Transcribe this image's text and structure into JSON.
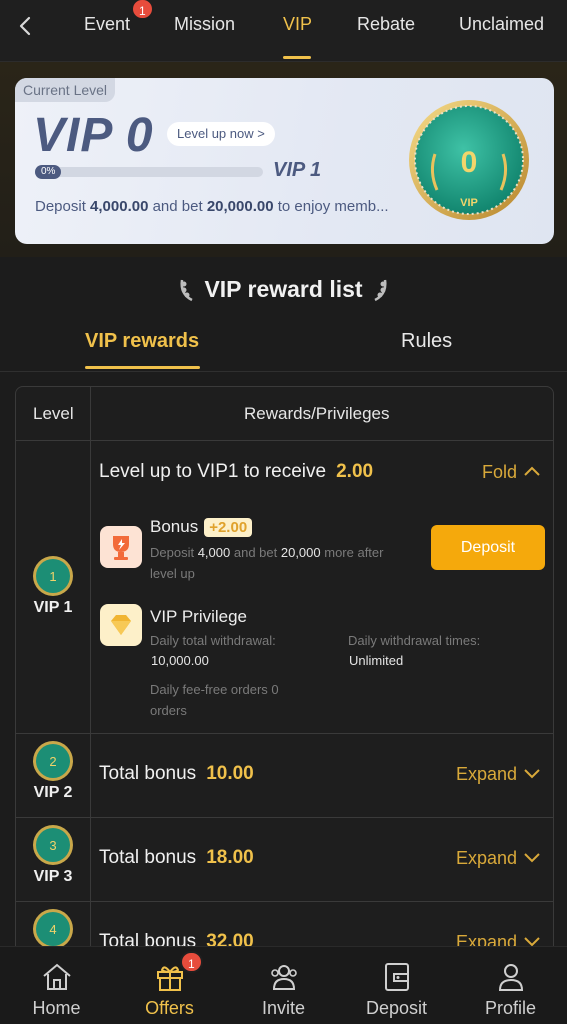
{
  "topnav": {
    "tabs": [
      {
        "label": "Event",
        "badge": "1"
      },
      {
        "label": "Mission"
      },
      {
        "label": "VIP"
      },
      {
        "label": "Rebate"
      },
      {
        "label": "Unclaimed"
      }
    ],
    "active_tab": "VIP"
  },
  "level_card": {
    "tag": "Current Level",
    "current_level": "VIP 0",
    "level_up_label": "Level up now >",
    "progress_label": "0%",
    "progress_fraction": 0,
    "next_level": "VIP 1",
    "deposit_prefix": "Deposit ",
    "deposit_amount": "4,000.00",
    "bet_prefix": " and bet ",
    "bet_amount": "20,000.00",
    "suffix": " to enjoy memb...",
    "medal_number": "0",
    "medal_text": "VIP"
  },
  "reward_list": {
    "heading": "VIP reward list",
    "tabs": [
      "VIP rewards",
      "Rules"
    ],
    "columns": [
      "Level",
      "Rewards/Privileges"
    ],
    "expanded_row": {
      "level": "VIP 1",
      "medal_number": "1",
      "title": "Level up to VIP1 to receive",
      "amount": "2.00",
      "fold_label": "Fold",
      "bonus": {
        "title": "Bonus",
        "badge": "+2.00",
        "line1_a": "Deposit ",
        "line1_b": "4,000",
        "line1_c": " and bet ",
        "line1_d": "20,000",
        "line1_e": " more after",
        "line2": "level up",
        "button": "Deposit"
      },
      "privilege": {
        "title": "VIP Privilege",
        "withdrawal_label": "Daily total withdrawal:",
        "withdrawal_value": "10,000.00",
        "times_label": "Daily withdrawal times:",
        "times_value": "Unlimited",
        "feefree_line1": "Daily fee-free orders 0",
        "feefree_line2": "orders"
      }
    },
    "collapsed_rows": [
      {
        "level": "VIP 2",
        "medal_number": "2",
        "title": "Total bonus",
        "amount": "10.00",
        "expand_label": "Expand"
      },
      {
        "level": "VIP 3",
        "medal_number": "3",
        "title": "Total bonus",
        "amount": "18.00",
        "expand_label": "Expand"
      },
      {
        "level": "",
        "medal_number": "4",
        "title": "Total bonus",
        "amount": "32.00",
        "expand_label": "Expand"
      }
    ]
  },
  "bottomnav": {
    "items": [
      {
        "label": "Home",
        "icon": "home-icon"
      },
      {
        "label": "Offers",
        "icon": "gift-icon",
        "badge": "1"
      },
      {
        "label": "Invite",
        "icon": "people-icon"
      },
      {
        "label": "Deposit",
        "icon": "wallet-icon"
      },
      {
        "label": "Profile",
        "icon": "person-icon"
      }
    ],
    "active": "Offers"
  },
  "colors": {
    "accent_gold": "#f0c14b",
    "badge_red": "#e74c3c",
    "deposit_orange": "#f5a90c",
    "card_text": "#4c5a80"
  }
}
